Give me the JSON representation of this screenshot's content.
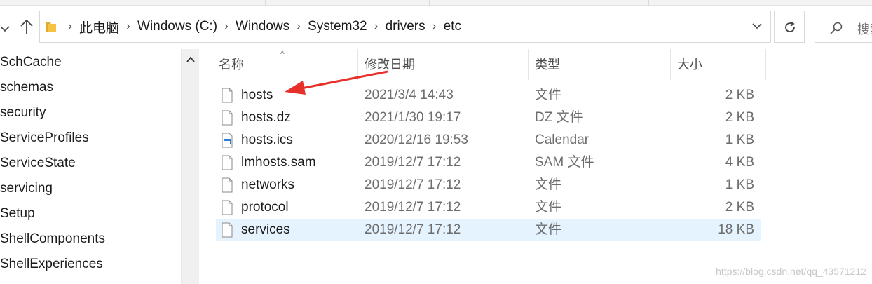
{
  "address_bar": {
    "crumbs": [
      "此电脑",
      "Windows (C:)",
      "Windows",
      "System32",
      "drivers",
      "etc"
    ]
  },
  "search": {
    "placeholder": "搜索"
  },
  "nav_pane": {
    "items": [
      "SchCache",
      "schemas",
      "security",
      "ServiceProfiles",
      "ServiceState",
      "servicing",
      "Setup",
      "ShellComponents",
      "ShellExperiences"
    ]
  },
  "columns": {
    "name": "名称",
    "date": "修改日期",
    "type": "类型",
    "size": "大小"
  },
  "files": [
    {
      "name": "hosts",
      "date": "2021/3/4 14:43",
      "type": "文件",
      "size": "2 KB",
      "icon": "file-icon"
    },
    {
      "name": "hosts.dz",
      "date": "2021/1/30 19:17",
      "type": "DZ 文件",
      "size": "2 KB",
      "icon": "file-icon"
    },
    {
      "name": "hosts.ics",
      "date": "2020/12/16 19:53",
      "type": "Calendar",
      "size": "1 KB",
      "icon": "calendar-file-icon"
    },
    {
      "name": "lmhosts.sam",
      "date": "2019/12/7 17:12",
      "type": "SAM 文件",
      "size": "4 KB",
      "icon": "file-icon"
    },
    {
      "name": "networks",
      "date": "2019/12/7 17:12",
      "type": "文件",
      "size": "1 KB",
      "icon": "file-icon"
    },
    {
      "name": "protocol",
      "date": "2019/12/7 17:12",
      "type": "文件",
      "size": "2 KB",
      "icon": "file-icon"
    },
    {
      "name": "services",
      "date": "2019/12/7 17:12",
      "type": "文件",
      "size": "18 KB",
      "icon": "file-icon",
      "selected": true
    }
  ],
  "watermark": "https://blog.csdn.net/qq_43571212",
  "colors": {
    "selection": "#e5f3ff",
    "annotation_arrow": "#e8302a",
    "folder": "#f5c343"
  }
}
